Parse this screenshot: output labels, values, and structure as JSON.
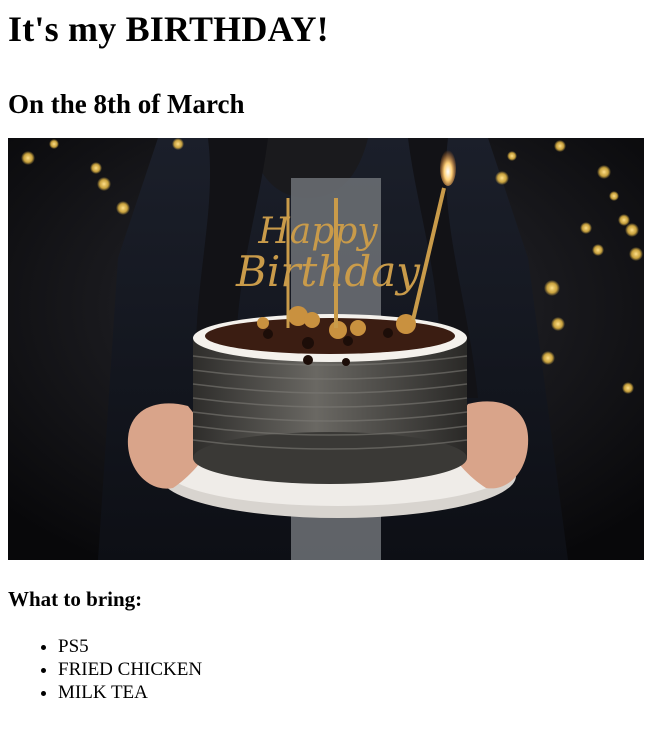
{
  "page": {
    "title": "It's my BIRTHDAY!",
    "subtitle": "On the 8th of March"
  },
  "photo": {
    "subject": "hands-holding-birthday-cake-with-candle-and-topper",
    "topper_text": "Happy Birthday",
    "colors": {
      "background": "#0f0f12",
      "bokeh": "#f5c548",
      "cake": "#4a4946",
      "plate": "#e9e6e2",
      "topper": "#c99b4a",
      "flame": "#ffd27a"
    }
  },
  "bring": {
    "heading": "What to bring:",
    "items": [
      "PS5",
      "FRIED CHICKEN",
      "MILK TEA"
    ]
  }
}
